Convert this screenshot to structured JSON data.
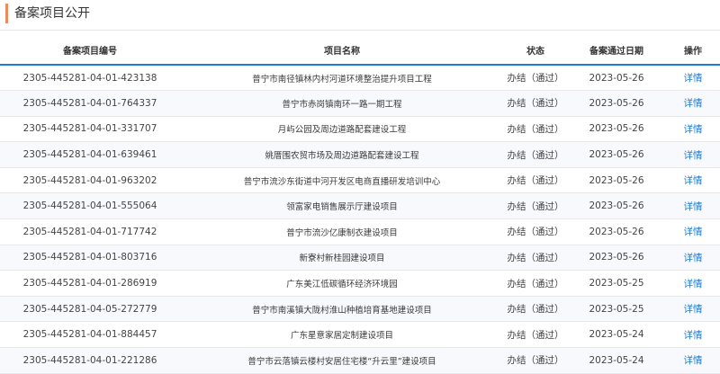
{
  "header": {
    "title": "备案项目公开"
  },
  "colors": {
    "accent": "#f08a5d",
    "link": "#1f7ad1",
    "header_rule": "#1f7ad1"
  },
  "table": {
    "columns": [
      "备案项目编号",
      "项目名称",
      "状态",
      "备案通过日期",
      "操作"
    ],
    "rows": [
      {
        "code": "2305-445281-04-01-423138",
        "name": "普宁市南径镇林内村河道环境整治提升项目工程",
        "status": "办结（通过）",
        "date": "2023-05-26",
        "action": "详情"
      },
      {
        "code": "2305-445281-04-01-764337",
        "name": "普宁市赤岗镇南环一路一期工程",
        "status": "办结（通过）",
        "date": "2023-05-26",
        "action": "详情"
      },
      {
        "code": "2305-445281-04-01-331707",
        "name": "月屿公园及周边道路配套建设工程",
        "status": "办结（通过）",
        "date": "2023-05-26",
        "action": "详情"
      },
      {
        "code": "2305-445281-04-01-639461",
        "name": "姚厝围农贸市场及周边道路配套建设工程",
        "status": "办结（通过）",
        "date": "2023-05-26",
        "action": "详情"
      },
      {
        "code": "2305-445281-04-01-963202",
        "name": "普宁市流沙东街道中河开发区电商直播研发培训中心",
        "status": "办结（通过）",
        "date": "2023-05-26",
        "action": "详情"
      },
      {
        "code": "2305-445281-04-01-555064",
        "name": "领富家电销售展示厅建设项目",
        "status": "办结（通过）",
        "date": "2023-05-26",
        "action": "详情"
      },
      {
        "code": "2305-445281-04-01-717742",
        "name": "普宁市流沙亿康制衣建设项目",
        "status": "办结（通过）",
        "date": "2023-05-26",
        "action": "详情"
      },
      {
        "code": "2305-445281-04-01-803716",
        "name": "新寮村新桂园建设项目",
        "status": "办结（通过）",
        "date": "2023-05-26",
        "action": "详情"
      },
      {
        "code": "2305-445281-04-01-286919",
        "name": "广东美江低碳循环经济环境园",
        "status": "办结（通过）",
        "date": "2023-05-25",
        "action": "详情"
      },
      {
        "code": "2305-445281-04-05-272779",
        "name": "普宁市南溪镇大陇村淮山种植培育基地建设项目",
        "status": "办结（通过）",
        "date": "2023-05-25",
        "action": "详情"
      },
      {
        "code": "2305-445281-04-01-884457",
        "name": "广东星意家居定制建设项目",
        "status": "办结（通过）",
        "date": "2023-05-24",
        "action": "详情"
      },
      {
        "code": "2305-445281-04-01-221286",
        "name": "普宁市云落镇云楼村安居住宅楼“升云里”建设项目",
        "status": "办结（通过）",
        "date": "2023-05-24",
        "action": "详情"
      }
    ]
  }
}
